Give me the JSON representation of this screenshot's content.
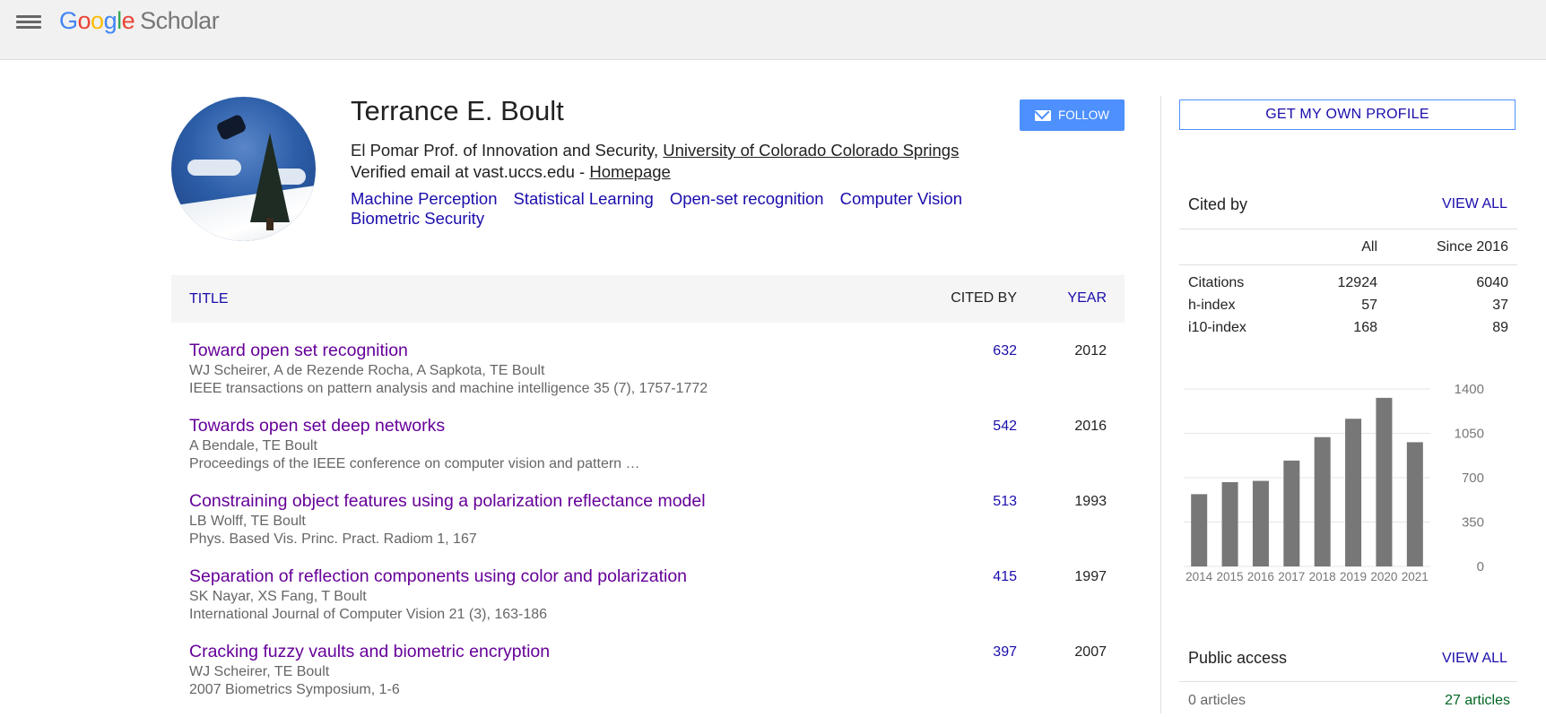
{
  "header": {
    "logo": [
      "G",
      "o",
      "o",
      "g",
      "l",
      "e"
    ],
    "logo_suffix": "Scholar"
  },
  "profile": {
    "name": "Terrance E. Boult",
    "affiliation_prefix": "El Pomar Prof. of Innovation and Security, ",
    "affiliation_link": "University of Colorado Colorado Springs",
    "verified_prefix": "Verified email at vast.uccs.edu - ",
    "homepage_link": "Homepage",
    "interests": [
      "Machine Perception",
      "Statistical Learning",
      "Open-set recognition",
      "Computer Vision",
      "Biometric Security"
    ],
    "follow_label": "FOLLOW"
  },
  "table": {
    "headers": {
      "title": "TITLE",
      "cited_by": "CITED BY",
      "year": "YEAR"
    },
    "rows": [
      {
        "title": "Toward open set recognition",
        "authors": "WJ Scheirer, A de Rezende Rocha, A Sapkota, TE Boult",
        "venue": "IEEE transactions on pattern analysis and machine intelligence 35 (7), 1757-1772",
        "cited": "632",
        "year": "2012"
      },
      {
        "title": "Towards open set deep networks",
        "authors": "A Bendale, TE Boult",
        "venue": "Proceedings of the IEEE conference on computer vision and pattern …",
        "cited": "542",
        "year": "2016"
      },
      {
        "title": "Constraining object features using a polarization reflectance model",
        "authors": "LB Wolff, TE Boult",
        "venue": "Phys. Based Vis. Princ. Pract. Radiom 1, 167",
        "cited": "513",
        "year": "1993"
      },
      {
        "title": "Separation of reflection components using color and polarization",
        "authors": "SK Nayar, XS Fang, T Boult",
        "venue": "International Journal of Computer Vision 21 (3), 163-186",
        "cited": "415",
        "year": "1997"
      },
      {
        "title": "Cracking fuzzy vaults and biometric encryption",
        "authors": "WJ Scheirer, TE Boult",
        "venue": "2007 Biometrics Symposium, 1-6",
        "cited": "397",
        "year": "2007"
      }
    ]
  },
  "sidebar": {
    "own_profile_label": "GET MY OWN PROFILE",
    "cited_by": {
      "title": "Cited by",
      "view_all": "VIEW ALL",
      "col_all": "All",
      "col_since": "Since 2016",
      "rows": [
        {
          "label": "Citations",
          "all": "12924",
          "since": "6040"
        },
        {
          "label": "h-index",
          "all": "57",
          "since": "37"
        },
        {
          "label": "i10-index",
          "all": "168",
          "since": "89"
        }
      ]
    },
    "public_access": {
      "title": "Public access",
      "view_all": "VIEW ALL",
      "left": "0 articles",
      "right": "27 articles"
    }
  },
  "chart_data": {
    "type": "bar",
    "categories": [
      "2014",
      "2015",
      "2016",
      "2017",
      "2018",
      "2019",
      "2020",
      "2021"
    ],
    "values": [
      570,
      665,
      675,
      835,
      1020,
      1165,
      1330,
      980
    ],
    "ylim": [
      0,
      1400
    ],
    "yticks": [
      "0",
      "350",
      "700",
      "1050",
      "1400"
    ],
    "bar_color": "#777777",
    "grid": true
  }
}
